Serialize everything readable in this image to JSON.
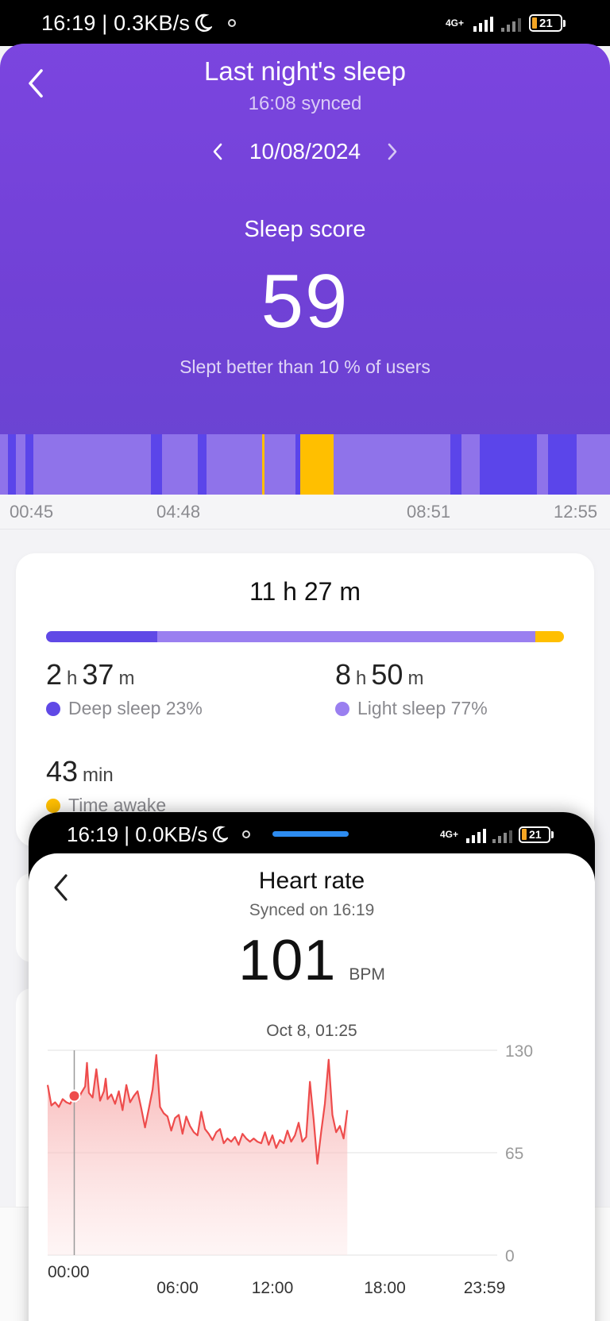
{
  "status_bar": {
    "time": "16:19 | 0.3KB/s",
    "network": "4G+",
    "battery": "21"
  },
  "header": {
    "title": "Last night's sleep",
    "subtitle": "16:08 synced",
    "date": "10/08/2024",
    "score_label": "Sleep score",
    "score": "59",
    "percentile": "Slept better than 10 % of users"
  },
  "timeline": {
    "ticks": [
      "00:45",
      "04:48",
      "08:51",
      "12:55"
    ]
  },
  "summary": {
    "total": "11 h 27 m",
    "deep": {
      "hours": "2",
      "h_unit": "h",
      "mins": "37",
      "m_unit": "m",
      "label": "Deep sleep 23%",
      "color": "#6049e6"
    },
    "light": {
      "hours": "8",
      "h_unit": "h",
      "mins": "50",
      "m_unit": "m",
      "label": "Light sleep 77%",
      "color": "#9a7ff0"
    },
    "awake": {
      "value": "43",
      "unit": "min",
      "label": "Time awake",
      "color": "#ffbf00"
    },
    "bar_fractions": {
      "deep": 0.215,
      "light": 0.73,
      "awake": 0.055
    }
  },
  "overlay": {
    "status_time": "16:19 | 0.0KB/s",
    "network": "4G+",
    "battery": "21",
    "title": "Heart rate",
    "subtitle": "Synced on 16:19",
    "value": "101",
    "unit": "BPM",
    "date": "Oct 8, 01:25"
  },
  "chart_data": {
    "type": "area",
    "title": "",
    "xlabel": "",
    "ylabel": "",
    "x_ticks": [
      "00:00",
      "06:00",
      "12:00",
      "18:00",
      "23:59"
    ],
    "y_ticks": [
      130,
      65,
      0
    ],
    "ylim": [
      0,
      130
    ],
    "xlim_hours": [
      0,
      24
    ],
    "selected_point": {
      "x_hour": 1.42,
      "y": 101
    },
    "series": [
      {
        "x_hours": [
          0.0,
          0.2,
          0.4,
          0.6,
          0.8,
          1.0,
          1.2,
          1.4,
          1.6,
          1.8,
          2.0,
          2.1,
          2.2,
          2.4,
          2.6,
          2.8,
          3.0,
          3.1,
          3.2,
          3.4,
          3.6,
          3.8,
          4.0,
          4.2,
          4.4,
          4.6,
          4.8,
          5.0,
          5.2,
          5.4,
          5.6,
          5.8,
          6.0,
          6.2,
          6.4,
          6.6,
          6.8,
          7.0,
          7.2,
          7.4,
          7.6,
          7.8,
          8.0,
          8.2,
          8.4,
          8.6,
          8.8,
          9.0,
          9.2,
          9.4,
          9.6,
          9.8,
          10.0,
          10.2,
          10.4,
          10.6,
          10.8,
          11.0,
          11.2,
          11.4,
          11.6,
          11.8,
          12.0,
          12.2,
          12.4,
          12.6,
          12.8,
          13.0,
          13.2,
          13.4,
          13.6,
          13.8,
          14.0,
          14.2,
          14.4,
          14.6,
          14.8,
          15.0,
          15.2,
          15.4,
          15.6,
          15.8,
          16.0
        ],
        "values": [
          108,
          95,
          97,
          94,
          99,
          97,
          96,
          101,
          98,
          103,
          107,
          122,
          103,
          100,
          118,
          98,
          104,
          112,
          99,
          102,
          96,
          104,
          92,
          108,
          97,
          101,
          104,
          93,
          81,
          93,
          105,
          127,
          94,
          90,
          88,
          79,
          87,
          89,
          77,
          88,
          82,
          78,
          76,
          91,
          80,
          77,
          73,
          78,
          80,
          71,
          74,
          72,
          75,
          70,
          77,
          74,
          72,
          74,
          72,
          71,
          78,
          70,
          76,
          68,
          73,
          71,
          79,
          72,
          76,
          84,
          72,
          75,
          110,
          86,
          58,
          78,
          96,
          124,
          89,
          78,
          82,
          74,
          92,
          81,
          75,
          99,
          66
        ]
      }
    ]
  }
}
